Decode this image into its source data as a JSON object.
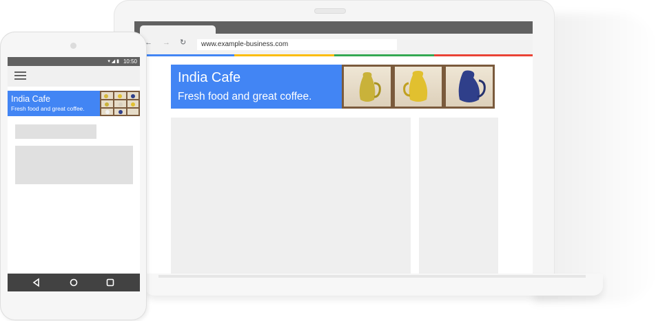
{
  "desktop": {
    "browser": {
      "url": "www.example-business.com",
      "nav_icons": [
        "back-arrow-icon",
        "forward-arrow-icon",
        "reload-icon"
      ],
      "accent_colors": [
        "#4285f4",
        "#fbbc05",
        "#34a853",
        "#ea4335"
      ]
    },
    "site": {
      "title": "India Cafe",
      "subtitle": "Fresh food and great coffee.",
      "banner_color": "#4285f4"
    }
  },
  "mobile": {
    "status_bar": {
      "time": "10:50",
      "icons": [
        "wifi-icon",
        "signal-icon",
        "battery-icon"
      ]
    },
    "menu_icon": "hamburger-menu-icon",
    "site": {
      "title": "India Cafe",
      "subtitle": "Fresh food and great coffee."
    },
    "nav_buttons": [
      "back-icon",
      "home-icon",
      "recents-icon"
    ]
  }
}
